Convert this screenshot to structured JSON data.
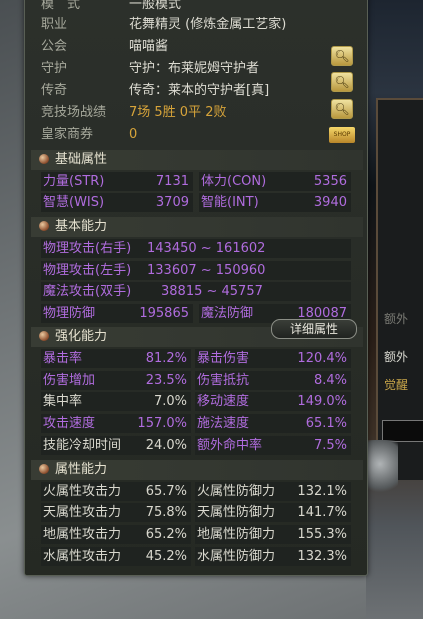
{
  "info": [
    {
      "label": "模　式",
      "value": "一般模式"
    },
    {
      "label": "职业",
      "value": "花舞精灵 (修炼金属工艺家)"
    },
    {
      "label": "公会",
      "value": "喵喵酱"
    },
    {
      "label": "守护",
      "value": "守护：布莱妮姆守护者"
    },
    {
      "label": "传奇",
      "value": "传奇：莱本的守护者[真]"
    },
    {
      "label": "竞技场战绩",
      "value": "7场 5胜 0平 2败"
    },
    {
      "label": "皇家商券",
      "value": "0"
    }
  ],
  "icons": {
    "search": "magnifier-icon",
    "shop": "royal-voucher-icon",
    "bullet": "orb-bullet-icon"
  },
  "shop_label": "SHOP",
  "sections": {
    "basic_attr": "基础属性",
    "basic_ability": "基本能力",
    "enhance": "强化能力",
    "element": "属性能力"
  },
  "detail_button": "详细属性",
  "basic_attr": [
    {
      "label": "力量(STR)",
      "value": "7131"
    },
    {
      "label": "体力(CON)",
      "value": "5356"
    },
    {
      "label": "智慧(WIS)",
      "value": "3709"
    },
    {
      "label": "智能(INT)",
      "value": "3940"
    }
  ],
  "basic_ability_ranges": [
    {
      "label": "物理攻击(右手)",
      "value": "143450 ~ 161602"
    },
    {
      "label": "物理攻击(左手)",
      "value": "133607 ~ 150960"
    },
    {
      "label": "魔法攻击(双手)",
      "value": "38815 ~ 45757"
    }
  ],
  "defense": [
    {
      "label": "物理防御",
      "value": "195865"
    },
    {
      "label": "魔法防御",
      "value": "180087"
    }
  ],
  "enhance": [
    {
      "label": "暴击率",
      "value": "81.2%"
    },
    {
      "label": "暴击伤害",
      "value": "120.4%"
    },
    {
      "label": "伤害增加",
      "value": "23.5%"
    },
    {
      "label": "伤害抵抗",
      "value": "8.4%"
    },
    {
      "label": "集中率",
      "value": "7.0%"
    },
    {
      "label": "移动速度",
      "value": "149.0%"
    },
    {
      "label": "攻击速度",
      "value": "157.0%"
    },
    {
      "label": "施法速度",
      "value": "65.1%"
    },
    {
      "label": "技能冷却时间",
      "value": "24.0%"
    },
    {
      "label": "额外命中率",
      "value": "7.5%"
    }
  ],
  "element": [
    {
      "label": "火属性攻击力",
      "value": "65.7%"
    },
    {
      "label": "火属性防御力",
      "value": "132.1%"
    },
    {
      "label": "天属性攻击力",
      "value": "75.8%"
    },
    {
      "label": "天属性防御力",
      "value": "141.7%"
    },
    {
      "label": "地属性攻击力",
      "value": "65.2%"
    },
    {
      "label": "地属性防御力",
      "value": "155.3%"
    },
    {
      "label": "水属性攻击力",
      "value": "45.2%"
    },
    {
      "label": "水属性防御力",
      "value": "132.3%"
    }
  ],
  "right_panel": {
    "line1": "额外",
    "line2": "觉醒",
    "line3": "额外"
  },
  "colors": {
    "purple": "#b06cde",
    "gold": "#d7a43a",
    "panel": "#2a2e29"
  }
}
